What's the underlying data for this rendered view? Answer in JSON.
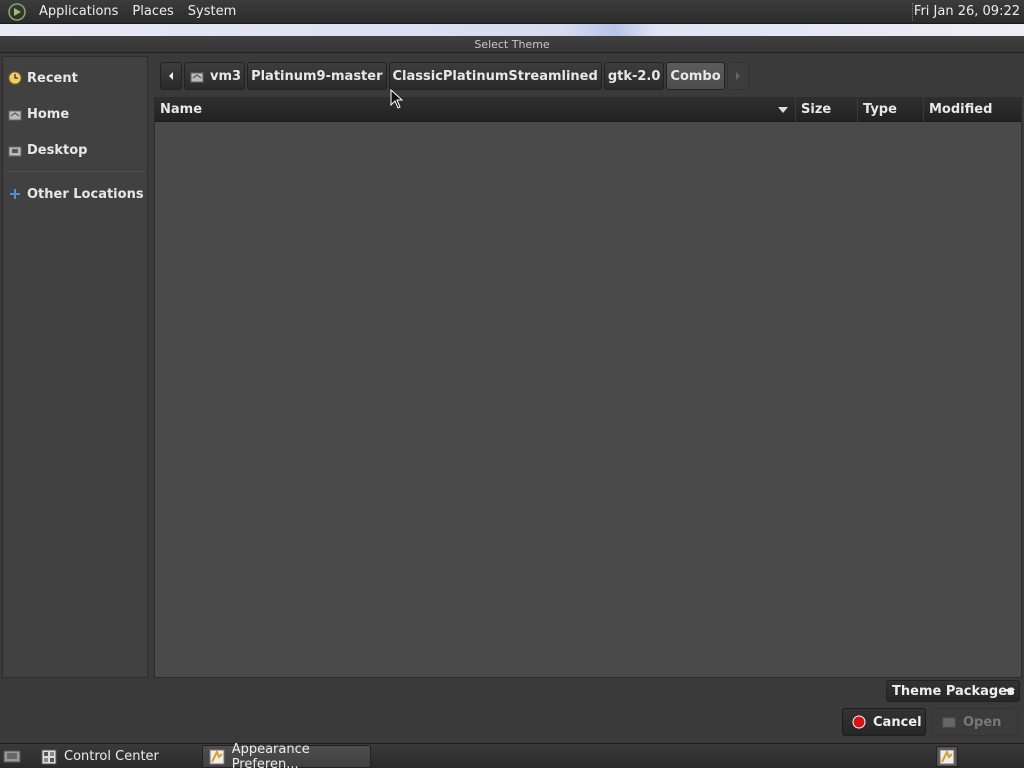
{
  "top_panel": {
    "menus": [
      "Applications",
      "Places",
      "System"
    ],
    "clock": "Fri Jan 26, 09:22"
  },
  "dialog": {
    "title": "Select Theme"
  },
  "sidebar": {
    "items": [
      {
        "label": "Recent",
        "icon": "clock-icon"
      },
      {
        "label": "Home",
        "icon": "home-folder-icon"
      },
      {
        "label": "Desktop",
        "icon": "desktop-folder-icon"
      },
      {
        "label": "Other Locations",
        "icon": "plus-icon"
      }
    ]
  },
  "pathbar": {
    "segments": [
      "vm3",
      "Platinum9-master",
      "ClassicPlatinumStreamlined",
      "gtk-2.0",
      "Combo"
    ],
    "active_segment": "Combo"
  },
  "filelist": {
    "columns": [
      "Name",
      "Size",
      "Type",
      "Modified"
    ],
    "sort_column": "Name",
    "rows": []
  },
  "filter": {
    "selected": "Theme Packages"
  },
  "buttons": {
    "cancel": "Cancel",
    "open": "Open"
  },
  "taskbar": {
    "tasks": [
      {
        "label": "Control Center",
        "icon": "control-center-icon"
      },
      {
        "label": "Appearance Preferen...",
        "icon": "appearance-icon"
      }
    ]
  },
  "colors": {
    "background": "#3a3a3a",
    "cancel_icon": "#e01010",
    "accent_blue": "#4a90d9"
  }
}
